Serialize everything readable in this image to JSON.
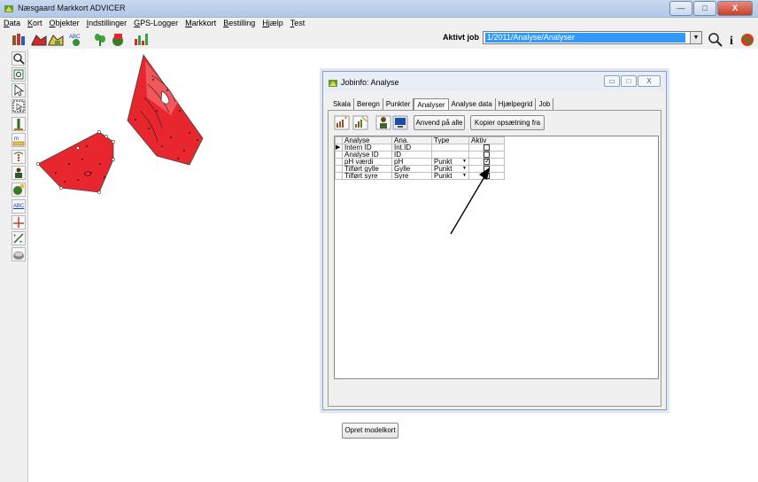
{
  "window": {
    "title": "Næsgaard Markkort ADVICER",
    "min": "—",
    "max": "□",
    "close": "X"
  },
  "menu": [
    "Data",
    "Kort",
    "Objekter",
    "Indstillinger",
    "GPS-Logger",
    "Markkort",
    "Bestilling",
    "Hjælp",
    "Test"
  ],
  "toolbar": {
    "aktiv_job_label": "Aktivt job",
    "aktiv_job_value": "1/2011/Analyse/Analyser",
    "icons": [
      "library-icon",
      "field-icon",
      "field-edit-icon",
      "abc-label-icon",
      "crop-icon",
      "field-paint-icon",
      "chart-bars-icon",
      "search-icon",
      "info-icon",
      "stop-icon"
    ]
  },
  "left_tools": [
    "zoom-icon",
    "zoom-fit-icon",
    "pointer-icon",
    "select-icon",
    "marker-icon",
    "measure-icon",
    "soil-sample-icon",
    "person-icon",
    "add-point-icon",
    "abc-text-icon",
    "crosshair-icon",
    "distance-icon",
    "eraser-icon"
  ],
  "dialog": {
    "title": "Jobinfo: Analyse",
    "min": "▭",
    "max": "□",
    "close": "X",
    "tabs": [
      "Skala",
      "Beregn",
      "Punkter",
      "Analyser",
      "Analyse data",
      "Hjælpegrid",
      "Job"
    ],
    "active_tab": "Analyser",
    "btn_apply_all": "Anvend på alle",
    "btn_copy_setup": "Kopier opsætning fra",
    "columns": [
      "Analyse",
      "Ana.",
      "Type",
      "Aktiv"
    ],
    "rows": [
      {
        "analyse": "Intern ID",
        "ana": "Int.ID",
        "type": "",
        "aktiv": false,
        "selected": true
      },
      {
        "analyse": "Analyse ID",
        "ana": "ID",
        "type": "",
        "aktiv": false,
        "selected": false
      },
      {
        "analyse": "pH værdi",
        "ana": "pH",
        "type": "Punkt",
        "aktiv": true,
        "selected": false
      },
      {
        "analyse": "Tilført gylle",
        "ana": "Gylle",
        "type": "Punkt",
        "aktiv": false,
        "selected": false
      },
      {
        "analyse": "Tilført syre",
        "ana": "Syre",
        "type": "Punkt",
        "aktiv": false,
        "selected": false
      }
    ],
    "btn_create_model": "Opret modelkort"
  },
  "colors": {
    "field_red": "#e8262d",
    "selection_blue": "#3399ff",
    "titlebar": "#c0d3ec"
  }
}
